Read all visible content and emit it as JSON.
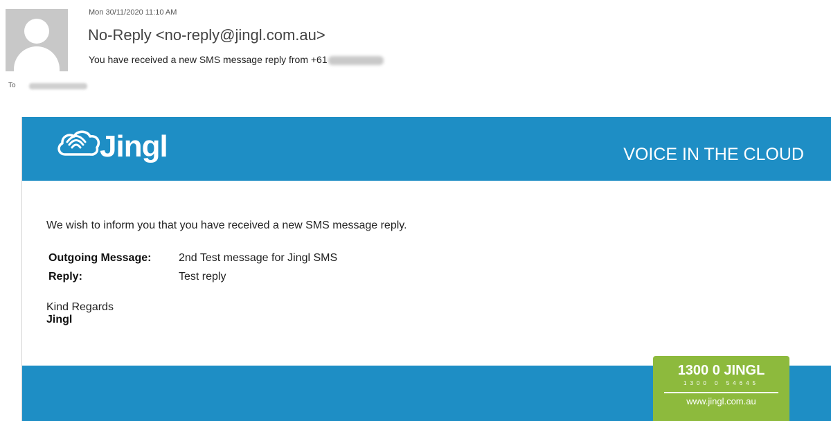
{
  "email": {
    "date": "Mon 30/11/2020 11:10 AM",
    "sender": "No-Reply <no-reply@jingl.com.au>",
    "subject": "You have received a new SMS message reply from +61",
    "to_label": "To"
  },
  "banner": {
    "logo_text": "Jingl",
    "tagline": "VOICE IN THE CLOUD"
  },
  "body": {
    "intro": "We wish to inform you that you have received a new SMS message reply.",
    "fields": [
      {
        "label": "Outgoing Message:",
        "value": "2nd Test message for Jingl SMS"
      },
      {
        "label": "Reply:",
        "value": "Test reply"
      }
    ],
    "closing": "Kind Regards",
    "signature": "Jingl"
  },
  "badge": {
    "phone": "1300 0 JINGL",
    "phone_digits": "1300 0 54645",
    "website": "www.jingl.com.au"
  },
  "colors": {
    "brand_blue": "#1e8ec5",
    "badge_green": "#8dba3d"
  },
  "icons": [
    "avatar-icon",
    "cloud-signal-icon"
  ]
}
